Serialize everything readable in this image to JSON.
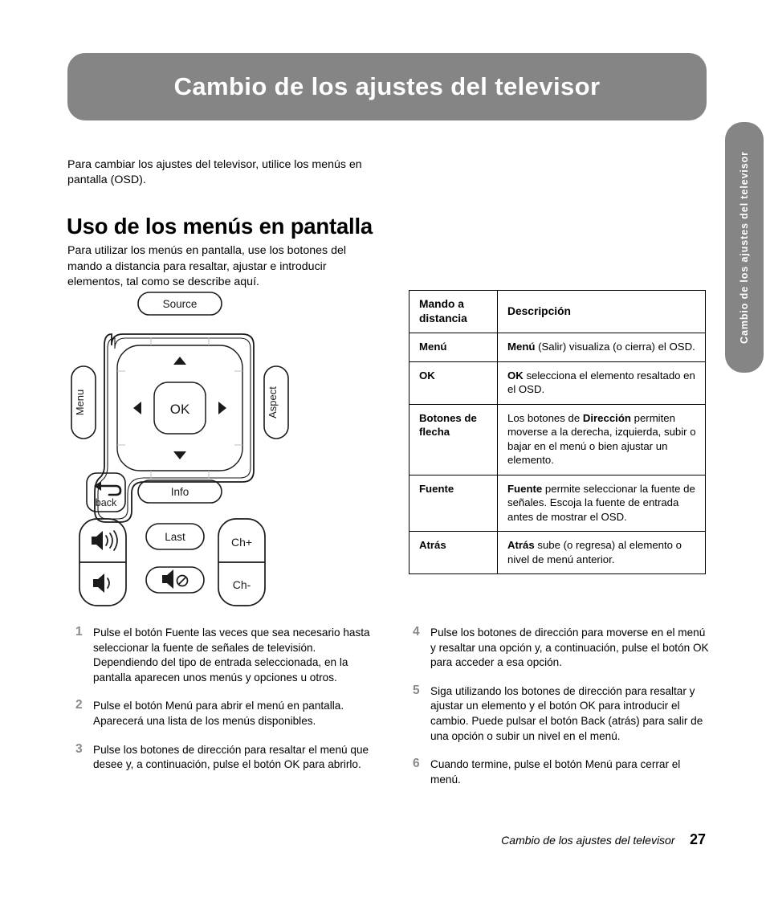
{
  "banner": {
    "title": "Cambio de los ajustes del televisor",
    "bg_color": "#858585",
    "text_color": "#ffffff"
  },
  "side_tab": {
    "label": "Cambio de los ajustes del televisor",
    "bg_color": "#858585"
  },
  "intro": "Para cambiar los ajustes del televisor, utilice los menús en pantalla (OSD).",
  "section": {
    "heading": "Uso de los menús en pantalla",
    "intro": "Para utilizar los menús en pantalla, use los botones del mando a distancia para resaltar, ajustar e introducir elementos, tal como se describe aquí."
  },
  "remote": {
    "source_label": "Source",
    "menu_label": "Menu",
    "aspect_label": "Aspect",
    "ok_label": "OK",
    "back_label": "back",
    "info_label": "Info",
    "last_label": "Last",
    "ch_up_label": "Ch+",
    "ch_down_label": "Ch-"
  },
  "table": {
    "header": {
      "col1": "Mando a distancia",
      "col2": "Descripción"
    },
    "rows": [
      {
        "term": "Menú",
        "desc_bold": "Menú",
        "desc_rest": " (Salir) visualiza (o cierra) el OSD."
      },
      {
        "term": "OK",
        "desc_bold": "OK",
        "desc_rest": " selecciona el elemento resaltado en el OSD."
      },
      {
        "term": "Botones de flecha",
        "desc_pre": "Los botones de ",
        "desc_bold": "Dirección",
        "desc_rest": " permiten moverse a la derecha, izquierda, subir o bajar en el menú o bien ajustar un elemento."
      },
      {
        "term": "Fuente",
        "desc_bold": "Fuente",
        "desc_rest": " permite seleccionar la fuente de señales. Escoja la fuente de entrada antes de mostrar el OSD."
      },
      {
        "term": "Atrás",
        "desc_bold": "Atrás",
        "desc_rest": " sube (o regresa) al elemento o nivel de menú anterior."
      }
    ]
  },
  "steps_left": [
    {
      "num": "1",
      "text": "Pulse el botón Fuente las veces que sea necesario hasta seleccionar la fuente de señales de televisión. Dependiendo del tipo de entrada seleccionada, en la pantalla aparecen unos menús y opciones u otros."
    },
    {
      "num": "2",
      "text": "Pulse el botón Menú para abrir el menú en pantalla. Aparecerá una lista de los menús disponibles."
    },
    {
      "num": "3",
      "text": "Pulse los botones de dirección para resaltar el menú que desee y, a continuación, pulse el botón OK para abrirlo."
    }
  ],
  "steps_right": [
    {
      "num": "4",
      "text": "Pulse los botones de dirección para moverse en el menú y resaltar una opción y, a continuación, pulse el botón OK para acceder a esa opción."
    },
    {
      "num": "5",
      "text": "Siga utilizando los botones de dirección para resaltar y ajustar un elemento y el botón OK para introducir el cambio. Puede pulsar el botón Back (atrás) para salir de una opción o subir un nivel en el menú."
    },
    {
      "num": "6",
      "text": "Cuando termine, pulse el botón Menú para cerrar el menú."
    }
  ],
  "footer": {
    "chapter": "Cambio de los ajustes del televisor",
    "page": "27"
  }
}
